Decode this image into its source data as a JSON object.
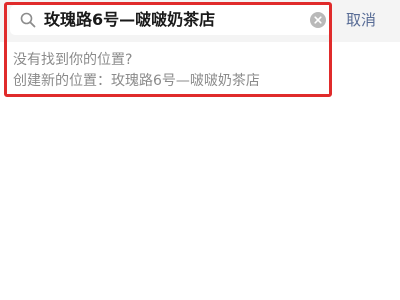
{
  "search": {
    "query": "玫瑰路6号—啵啵奶茶店",
    "cancel_label": "取消"
  },
  "suggestion": {
    "not_found": "没有找到你的位置?",
    "create_prefix": "创建新的位置：",
    "create_location": "玫瑰路6号—啵啵奶茶店"
  },
  "colors": {
    "accent_link": "#576b95",
    "highlight": "#e02b2b",
    "muted_text": "#8b8b8b"
  },
  "icons": {
    "search": "search-icon",
    "clear": "clear-icon"
  }
}
